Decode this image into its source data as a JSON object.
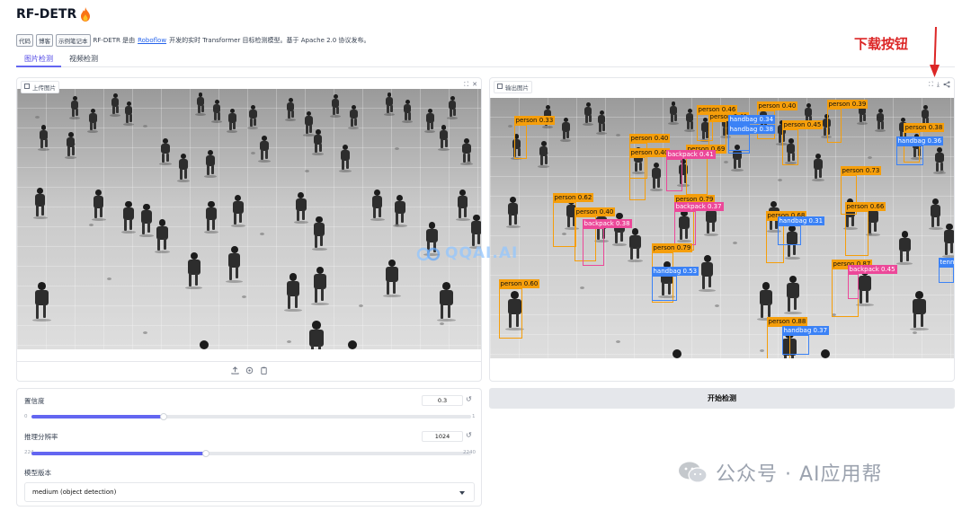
{
  "header": {
    "title": "RF-DETR",
    "tags": [
      "代码",
      "博客",
      "示例笔记本"
    ],
    "desc_prefix": "RF-DETR 是由",
    "desc_link": "Roboflow",
    "desc_suffix": "开发的实时 Transformer 目标检测模型。基于 Apache 2.0 协议发布。"
  },
  "tabs": [
    {
      "label": "图片检测",
      "active": true
    },
    {
      "label": "视频检测",
      "active": false
    }
  ],
  "input_panel": {
    "label": "上传图片",
    "tools": [
      "⛶",
      "✕"
    ],
    "bottom_icons": [
      "upload-icon",
      "webcam-icon",
      "clipboard-icon"
    ]
  },
  "output_panel": {
    "label": "输出图片",
    "tools": [
      "⛶",
      "⤓",
      "share"
    ]
  },
  "watermark_center": "QQAI.AI",
  "annotation": {
    "download_label": "下载按钮"
  },
  "detections": [
    {
      "label": "person 0.33",
      "cls": "person"
    },
    {
      "label": "person 0.40",
      "cls": "person"
    },
    {
      "label": "person 0.46",
      "cls": "person"
    },
    {
      "label": "person 0.41",
      "cls": "person"
    },
    {
      "label": "person 0.40",
      "cls": "person"
    },
    {
      "label": "person 0.39",
      "cls": "person"
    },
    {
      "label": "person 0.45",
      "cls": "person"
    },
    {
      "label": "person 0.38",
      "cls": "person"
    },
    {
      "label": "handbag 0.34",
      "cls": "bag-blue"
    },
    {
      "label": "handbag 0.38",
      "cls": "bag-blue"
    },
    {
      "label": "handbag 0.36",
      "cls": "bag-blue"
    },
    {
      "label": "person 0.40",
      "cls": "person"
    },
    {
      "label": "person 0.69",
      "cls": "person"
    },
    {
      "label": "backpack 0.41",
      "cls": "bag-pink"
    },
    {
      "label": "person 0.73",
      "cls": "person"
    },
    {
      "label": "person 0.62",
      "cls": "person"
    },
    {
      "label": "person 0.40",
      "cls": "person"
    },
    {
      "label": "backpack 0.38",
      "cls": "bag-pink"
    },
    {
      "label": "person 0.79",
      "cls": "person"
    },
    {
      "label": "backpack 0.37",
      "cls": "bag-pink"
    },
    {
      "label": "person 0.68",
      "cls": "person"
    },
    {
      "label": "handbag 0.31",
      "cls": "bag-blue"
    },
    {
      "label": "person 0.66",
      "cls": "person"
    },
    {
      "label": "person 0.79",
      "cls": "person"
    },
    {
      "label": "person 0.87",
      "cls": "person"
    },
    {
      "label": "backpack 0.45",
      "cls": "bag-pink"
    },
    {
      "label": "handbag 0.53",
      "cls": "bag-blue"
    },
    {
      "label": "person 0.60",
      "cls": "person"
    },
    {
      "label": "person 0.88",
      "cls": "person"
    },
    {
      "label": "handbag 0.37",
      "cls": "bag-blue"
    },
    {
      "label": "tenn",
      "cls": "bag-blue"
    }
  ],
  "settings": {
    "confidence": {
      "label": "置信度",
      "value": "0.3",
      "min": "0",
      "max": "1",
      "fraction": 0.3
    },
    "resolution": {
      "label": "推理分辨率",
      "value": "1024",
      "min": "224",
      "max": "2240",
      "fraction": 0.397
    },
    "model": {
      "label": "模型版本",
      "value": "medium (object detection)"
    }
  },
  "detect_button": "开始检测",
  "wechat_watermark": "公众号 · AI应用帮",
  "colors": {
    "accent": "#6366f1",
    "person_box": "#f59e0b",
    "backpack_box": "#ec4899",
    "handbag_box": "#3b82f6",
    "annotation_red": "#dc2626"
  }
}
